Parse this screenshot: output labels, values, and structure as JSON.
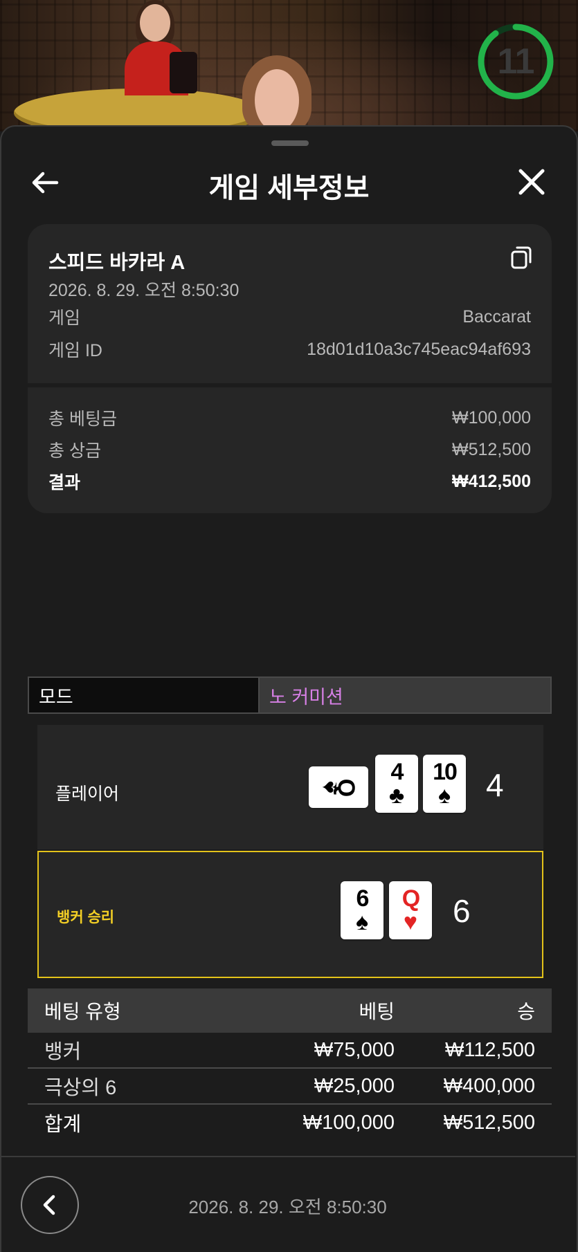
{
  "timer": {
    "seconds": "11",
    "progress": 0.9,
    "color": "#22b34a"
  },
  "header": {
    "title": "게임 세부정보"
  },
  "summary": {
    "game_name": "스피드 바카라 A",
    "date": "2026. 8. 29. 오전 8:50:30",
    "game_label": "게임",
    "game_value": "Baccarat",
    "game_id_label": "게임 ID",
    "game_id_value": "18d01d10a3c745eac94af693",
    "total_bet_label": "총 베팅금",
    "total_bet_value": "₩100,000",
    "total_win_label": "총 상금",
    "total_win_value": "₩512,500",
    "result_label": "결과",
    "result_value": "₩412,500"
  },
  "mode": {
    "label": "모드",
    "value": "노 커미션",
    "value_color": "#d780e6"
  },
  "hands": {
    "player": {
      "label": "플레이어",
      "score": "4",
      "cards": [
        {
          "rank": "Q",
          "suit": "♠",
          "color": "black",
          "orientation": "sideways"
        },
        {
          "rank": "4",
          "suit": "♣",
          "color": "black",
          "orientation": "upright"
        },
        {
          "rank": "10",
          "suit": "♠",
          "color": "black",
          "orientation": "upright"
        }
      ]
    },
    "banker": {
      "label": "뱅커 승리",
      "score": "6",
      "highlight_color": "#e4c31a",
      "cards": [
        {
          "rank": "6",
          "suit": "♠",
          "color": "black",
          "orientation": "upright"
        },
        {
          "rank": "Q",
          "suit": "♥",
          "color": "red",
          "orientation": "upright"
        }
      ]
    }
  },
  "bets": {
    "headers": {
      "type": "베팅 유형",
      "bet": "베팅",
      "win": "승"
    },
    "rows": [
      {
        "type": "뱅커",
        "bet": "₩75,000",
        "win": "₩112,500"
      },
      {
        "type": "극상의 6",
        "bet": "₩25,000",
        "win": "₩400,000"
      }
    ],
    "total": {
      "type": "합계",
      "bet": "₩100,000",
      "win": "₩512,500"
    }
  },
  "footer": {
    "date": "2026. 8. 29. 오전 8:50:30"
  },
  "icons": {
    "back": "arrow-left-icon",
    "close": "close-icon",
    "copy": "copy-icon",
    "footer_back": "chevron-left-icon"
  }
}
